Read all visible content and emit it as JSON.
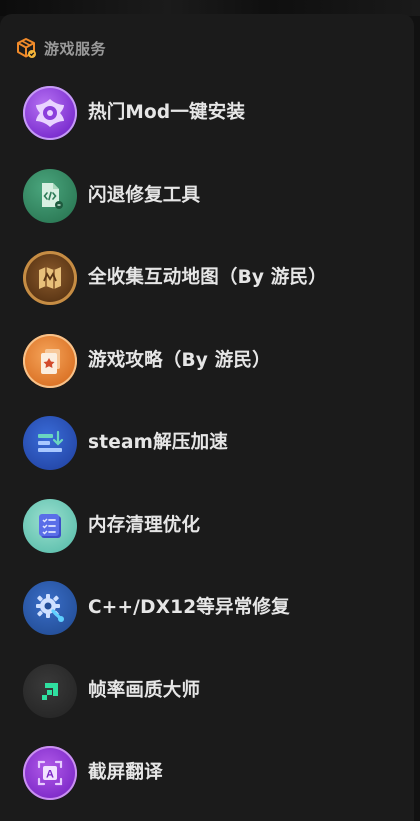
{
  "section": {
    "title": "游戏服务",
    "icon": "game-box-icon"
  },
  "items": [
    {
      "label": "热门Mod一键安装",
      "icon": "mod-install-icon",
      "color": "#8a3fd8"
    },
    {
      "label": "闪退修复工具",
      "icon": "code-file-repair-icon",
      "color": "#2f7d59"
    },
    {
      "label": "全收集互动地图（By 游民）",
      "icon": "map-icon",
      "color": "#6a4018"
    },
    {
      "label": "游戏攻略（By 游民）",
      "icon": "guide-cards-icon",
      "color": "#e07a2a"
    },
    {
      "label": "steam解压加速",
      "icon": "download-speed-icon",
      "color": "#2a52b8"
    },
    {
      "label": "内存清理优化",
      "icon": "checklist-icon",
      "color": "#6cc8b5"
    },
    {
      "label": "C++/DX12等异常修复",
      "icon": "gear-wrench-icon",
      "color": "#2a5aa8"
    },
    {
      "label": "帧率画质大师",
      "icon": "fps-arrow-icon",
      "color": "#2b2b2b"
    },
    {
      "label": "截屏翻译",
      "icon": "screenshot-translate-icon",
      "color": "#8a34d2"
    }
  ]
}
